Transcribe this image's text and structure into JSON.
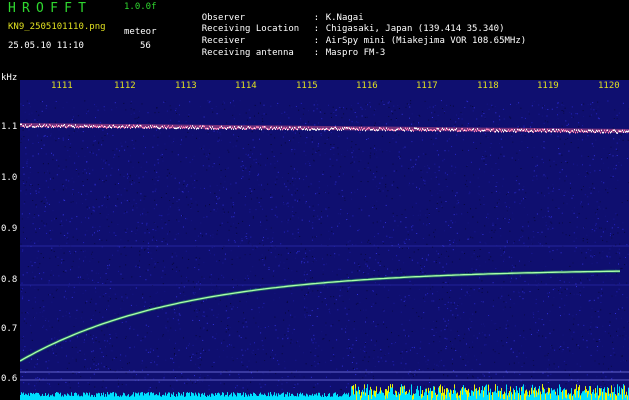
{
  "header": {
    "app_title": "HROFFT",
    "app_version": "1.0.0f",
    "file_name": "KN9_2505101110.png",
    "date_time": "25.05.10 11:10",
    "meteor_label": "meteor",
    "meteor_count": "56"
  },
  "station": [
    {
      "label": "Observer",
      "sep": ":",
      "value": "K.Nagai"
    },
    {
      "label": "Receiving Location",
      "sep": ":",
      "value": "Chigasaki, Japan (139.414 35.340)"
    },
    {
      "label": "Receiver",
      "sep": ":",
      "value": "AirSpy mini (Miakejima VOR 108.65MHz)"
    },
    {
      "label": "Receiving antenna",
      "sep": ":",
      "value": "Maspro FM-3"
    }
  ],
  "spectrogram": {
    "unit_label": "kHz",
    "freq_ticks": [
      "1.1",
      "1.0",
      "0.9",
      "0.8",
      "0.7",
      "0.6"
    ],
    "time_ticks": [
      "1111",
      "1112",
      "1113",
      "1114",
      "1115",
      "1116",
      "1117",
      "1118",
      "1119",
      "1120"
    ],
    "colors": {
      "background": "#0f0f70",
      "carrier": "#ff88bb",
      "trace": "#aaffaa",
      "power_cyan": "#00e0ff",
      "power_yellow": "#f0f000",
      "tick_text": "#e0e020"
    }
  }
}
